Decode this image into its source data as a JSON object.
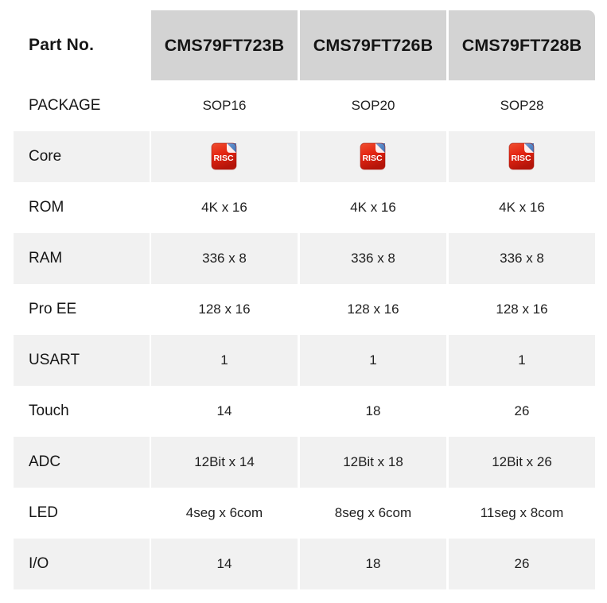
{
  "table": {
    "corner_label": "Part No.",
    "columns": [
      {
        "header": "CMS79FT723B"
      },
      {
        "header": "CMS79FT726B"
      },
      {
        "header": "CMS79FT728B"
      }
    ],
    "rows": [
      {
        "label": "PACKAGE",
        "shaded": false,
        "type": "text",
        "values": [
          "SOP16",
          "SOP20",
          "SOP28"
        ]
      },
      {
        "label": "Core",
        "shaded": true,
        "type": "icon",
        "values": [
          "RISC",
          "RISC",
          "RISC"
        ],
        "icon": "risc-icon"
      },
      {
        "label": "ROM",
        "shaded": false,
        "type": "text",
        "values": [
          "4K x 16",
          "4K x 16",
          "4K x 16"
        ]
      },
      {
        "label": "RAM",
        "shaded": true,
        "type": "text",
        "values": [
          "336 x 8",
          "336 x 8",
          "336 x 8"
        ]
      },
      {
        "label": "Pro EE",
        "shaded": false,
        "type": "text",
        "values": [
          "128 x 16",
          "128 x 16",
          "128 x 16"
        ]
      },
      {
        "label": "USART",
        "shaded": true,
        "type": "text",
        "values": [
          "1",
          "1",
          "1"
        ]
      },
      {
        "label": "Touch",
        "shaded": false,
        "type": "text",
        "values": [
          "14",
          "18",
          "26"
        ]
      },
      {
        "label": "ADC",
        "shaded": true,
        "type": "text",
        "values": [
          "12Bit x 14",
          "12Bit x 18",
          "12Bit x 26"
        ]
      },
      {
        "label": "LED",
        "shaded": false,
        "type": "text",
        "values": [
          "4seg x 6com",
          "8seg x 6com",
          "11seg x 8com"
        ]
      },
      {
        "label": "I/O",
        "shaded": true,
        "type": "text",
        "values": [
          "14",
          "18",
          "26"
        ]
      }
    ]
  },
  "colors": {
    "header_background": "#d3d3d3",
    "shaded_row_background": "#f1f1f1",
    "page_background": "#ffffff",
    "text": "#1a1a1a",
    "risc_icon_red": "#e02b1b",
    "risc_icon_blue": "#4a7fc1"
  },
  "icons": {
    "risc": {
      "name": "risc-icon",
      "label": "RISC"
    }
  }
}
